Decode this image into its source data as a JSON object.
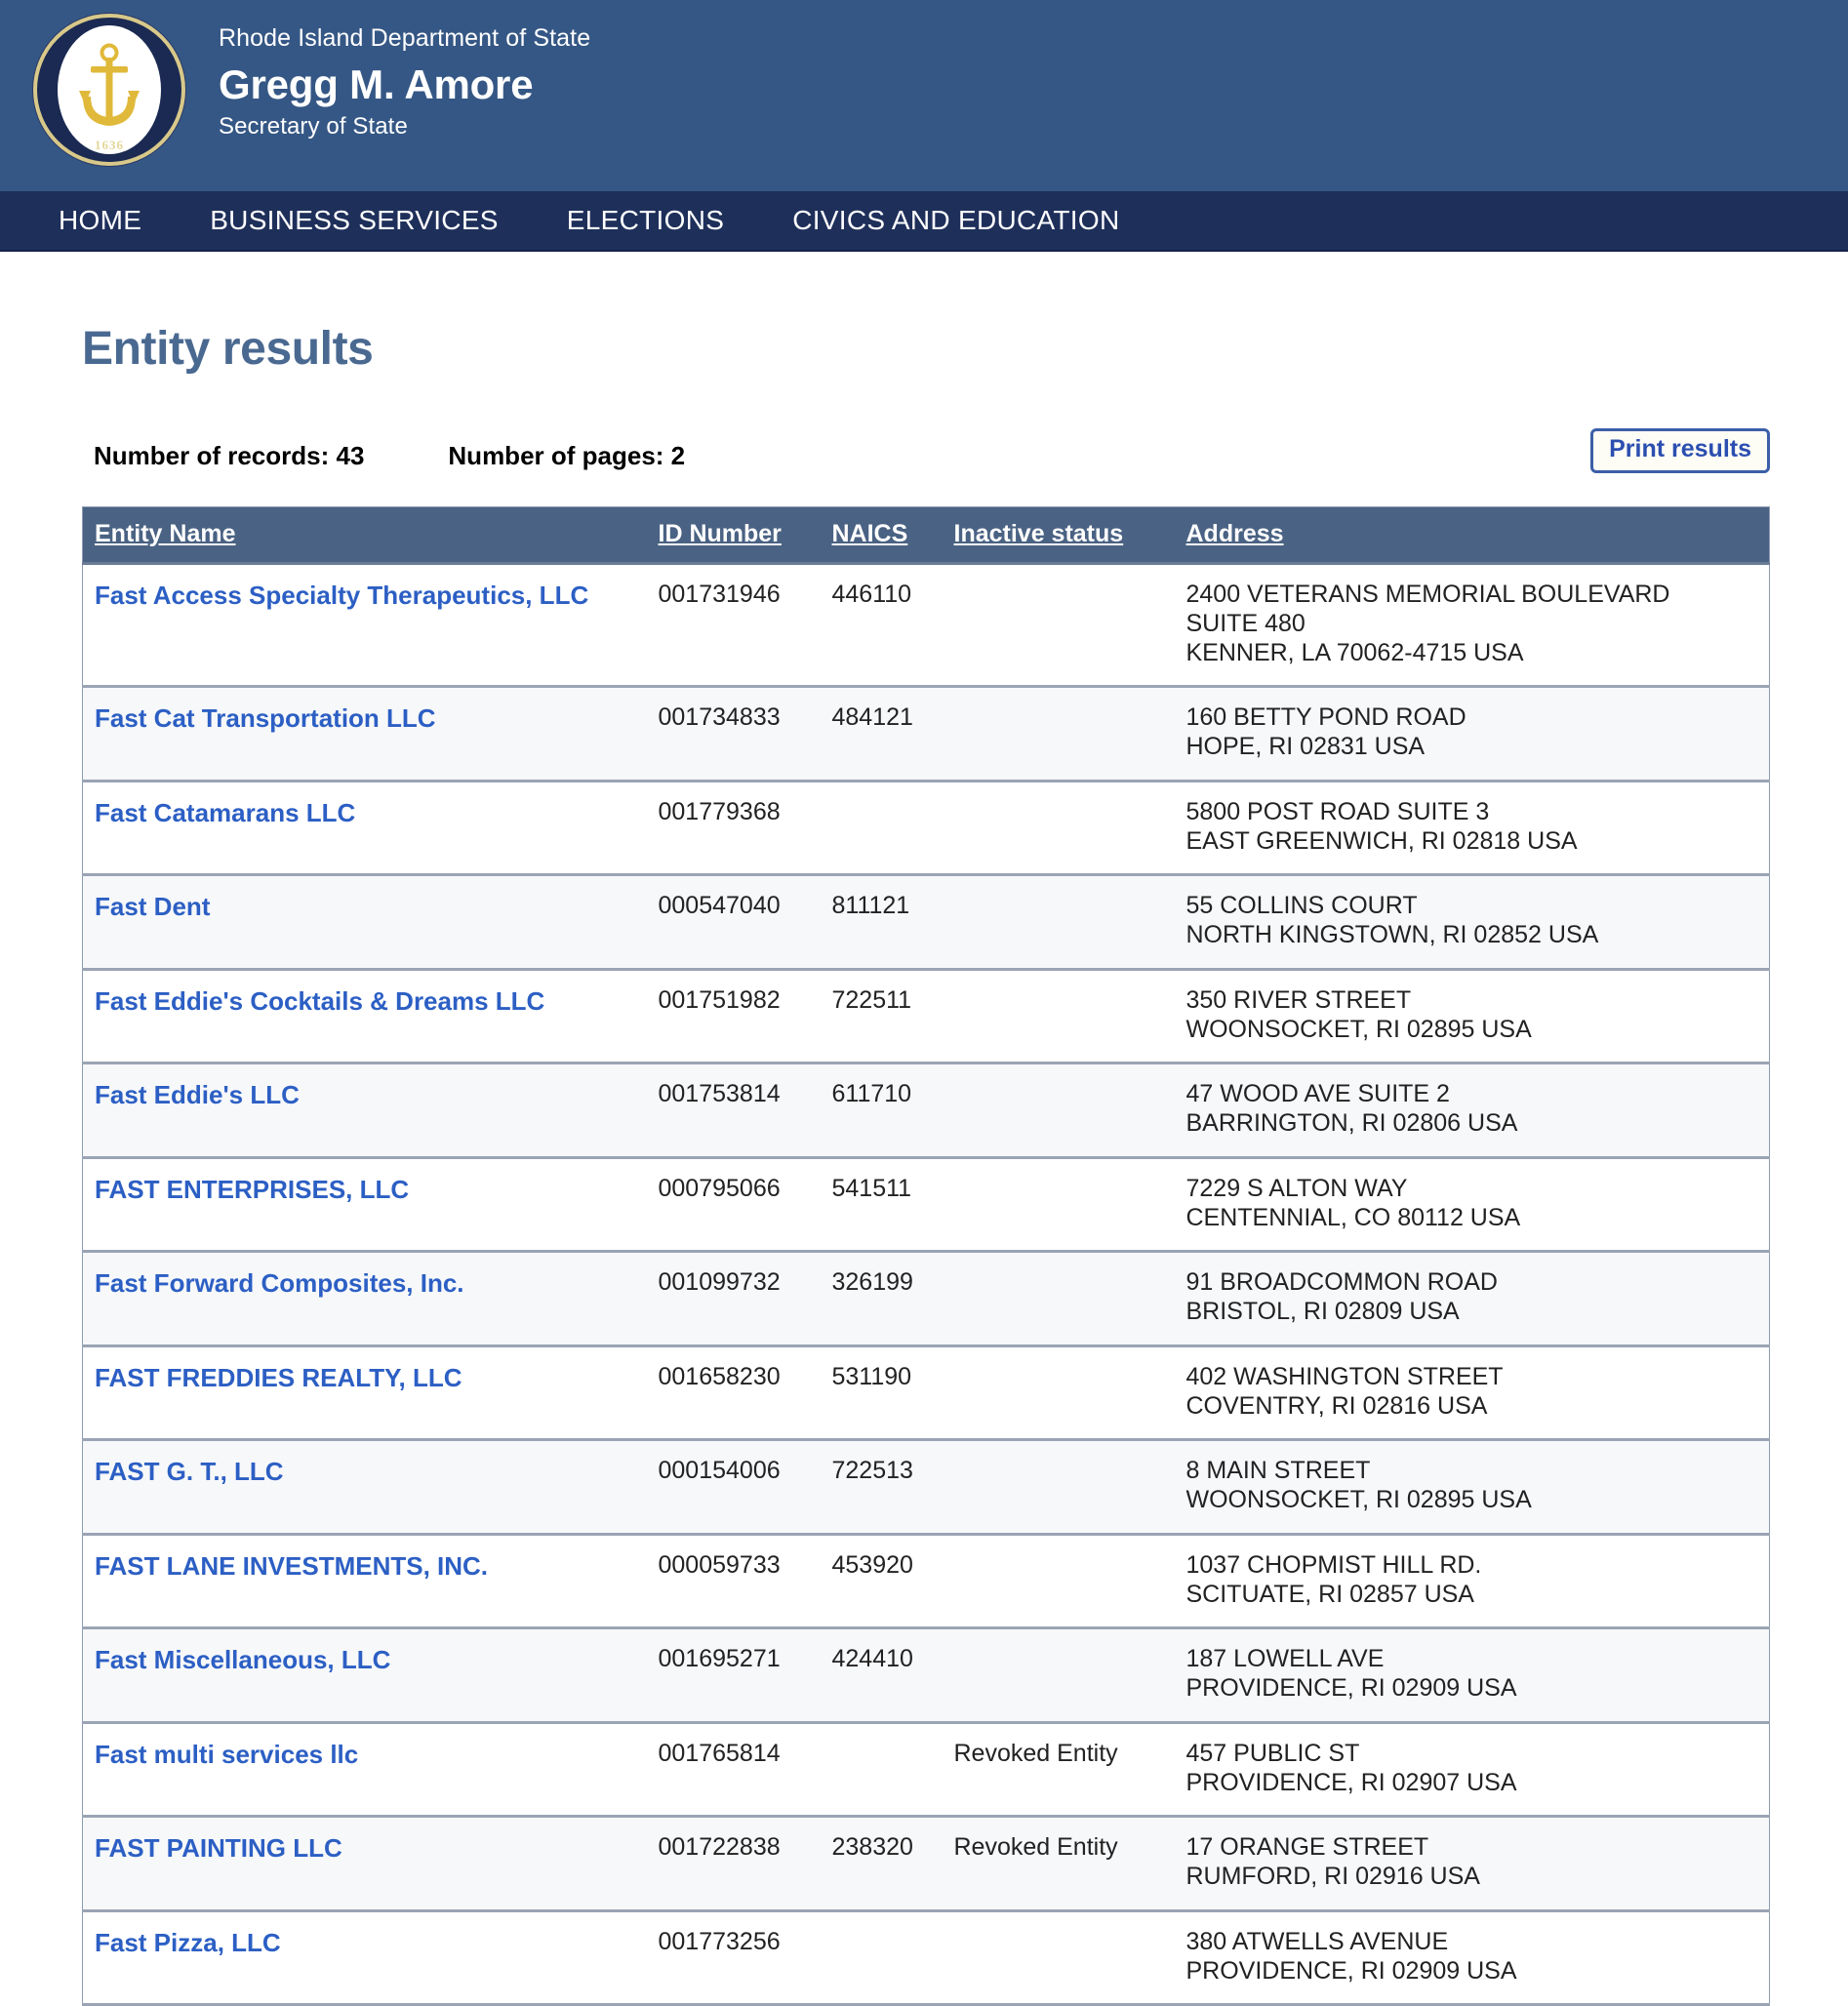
{
  "masthead": {
    "department": "Rhode Island Department of State",
    "official_name": "Gregg M. Amore",
    "role": "Secretary of State",
    "seal_year": "1636",
    "bg_color": "#355785"
  },
  "nav": {
    "bg_color": "#1e2f5a",
    "items": [
      {
        "label": "HOME"
      },
      {
        "label": "BUSINESS SERVICES"
      },
      {
        "label": "ELECTIONS"
      },
      {
        "label": "CIVICS AND EDUCATION"
      }
    ]
  },
  "page": {
    "title": "Entity results",
    "title_color": "#4a6991"
  },
  "summary": {
    "records_label": "Number of records: 43",
    "pages_label": "Number of pages: 2",
    "print_button": "Print results"
  },
  "table": {
    "header_bg": "#4a6283",
    "link_color": "#2c5fc4",
    "columns": [
      {
        "key": "name",
        "label": "Entity Name"
      },
      {
        "key": "id",
        "label": "ID Number"
      },
      {
        "key": "naics",
        "label": "NAICS"
      },
      {
        "key": "status",
        "label": "Inactive status"
      },
      {
        "key": "address",
        "label": "Address"
      }
    ],
    "rows": [
      {
        "name": "Fast Access Specialty Therapeutics, LLC",
        "id": "001731946",
        "naics": "446110",
        "status": "",
        "address": [
          "2400 VETERANS MEMORIAL BOULEVARD",
          "SUITE 480",
          "KENNER, LA 70062-4715 USA"
        ]
      },
      {
        "name": "Fast Cat Transportation LLC",
        "id": "001734833",
        "naics": "484121",
        "status": "",
        "address": [
          "160 BETTY POND ROAD",
          "HOPE, RI 02831 USA"
        ]
      },
      {
        "name": "Fast Catamarans LLC",
        "id": "001779368",
        "naics": "",
        "status": "",
        "address": [
          "5800 POST ROAD SUITE 3",
          "EAST GREENWICH, RI 02818 USA"
        ]
      },
      {
        "name": "Fast Dent",
        "id": "000547040",
        "naics": "811121",
        "status": "",
        "address": [
          "55 COLLINS COURT",
          "NORTH KINGSTOWN, RI 02852 USA"
        ]
      },
      {
        "name": "Fast Eddie's Cocktails & Dreams LLC",
        "id": "001751982",
        "naics": "722511",
        "status": "",
        "address": [
          "350 RIVER STREET",
          "WOONSOCKET, RI 02895 USA"
        ]
      },
      {
        "name": "Fast Eddie's LLC",
        "id": "001753814",
        "naics": "611710",
        "status": "",
        "address": [
          "47 WOOD AVE SUITE 2",
          "BARRINGTON, RI 02806 USA"
        ]
      },
      {
        "name": "FAST ENTERPRISES, LLC",
        "id": "000795066",
        "naics": "541511",
        "status": "",
        "address": [
          "7229 S ALTON WAY",
          "CENTENNIAL, CO 80112 USA"
        ]
      },
      {
        "name": "Fast Forward Composites, Inc.",
        "id": "001099732",
        "naics": "326199",
        "status": "",
        "address": [
          "91 BROADCOMMON ROAD",
          "BRISTOL, RI 02809 USA"
        ]
      },
      {
        "name": "FAST FREDDIES REALTY, LLC",
        "id": "001658230",
        "naics": "531190",
        "status": "",
        "address": [
          "402 WASHINGTON STREET",
          "COVENTRY, RI 02816 USA"
        ]
      },
      {
        "name": "FAST G. T., LLC",
        "id": "000154006",
        "naics": "722513",
        "status": "",
        "address": [
          "8 MAIN STREET",
          "WOONSOCKET, RI 02895 USA"
        ]
      },
      {
        "name": "FAST LANE INVESTMENTS, INC.",
        "id": "000059733",
        "naics": "453920",
        "status": "",
        "address": [
          "1037 CHOPMIST HILL RD.",
          "SCITUATE, RI 02857 USA"
        ]
      },
      {
        "name": "Fast Miscellaneous, LLC",
        "id": "001695271",
        "naics": "424410",
        "status": "",
        "address": [
          "187 LOWELL AVE",
          "PROVIDENCE, RI 02909 USA"
        ]
      },
      {
        "name": "Fast multi services llc",
        "id": "001765814",
        "naics": "",
        "status": "Revoked Entity",
        "address": [
          "457 PUBLIC ST",
          "PROVIDENCE, RI 02907 USA"
        ]
      },
      {
        "name": "FAST PAINTING LLC",
        "id": "001722838",
        "naics": "238320",
        "status": "Revoked Entity",
        "address": [
          "17 ORANGE STREET",
          "RUMFORD, RI 02916 USA"
        ]
      },
      {
        "name": "Fast Pizza, LLC",
        "id": "001773256",
        "naics": "",
        "status": "",
        "address": [
          "380 ATWELLS AVENUE",
          "PROVIDENCE, RI 02909 USA"
        ]
      }
    ]
  }
}
